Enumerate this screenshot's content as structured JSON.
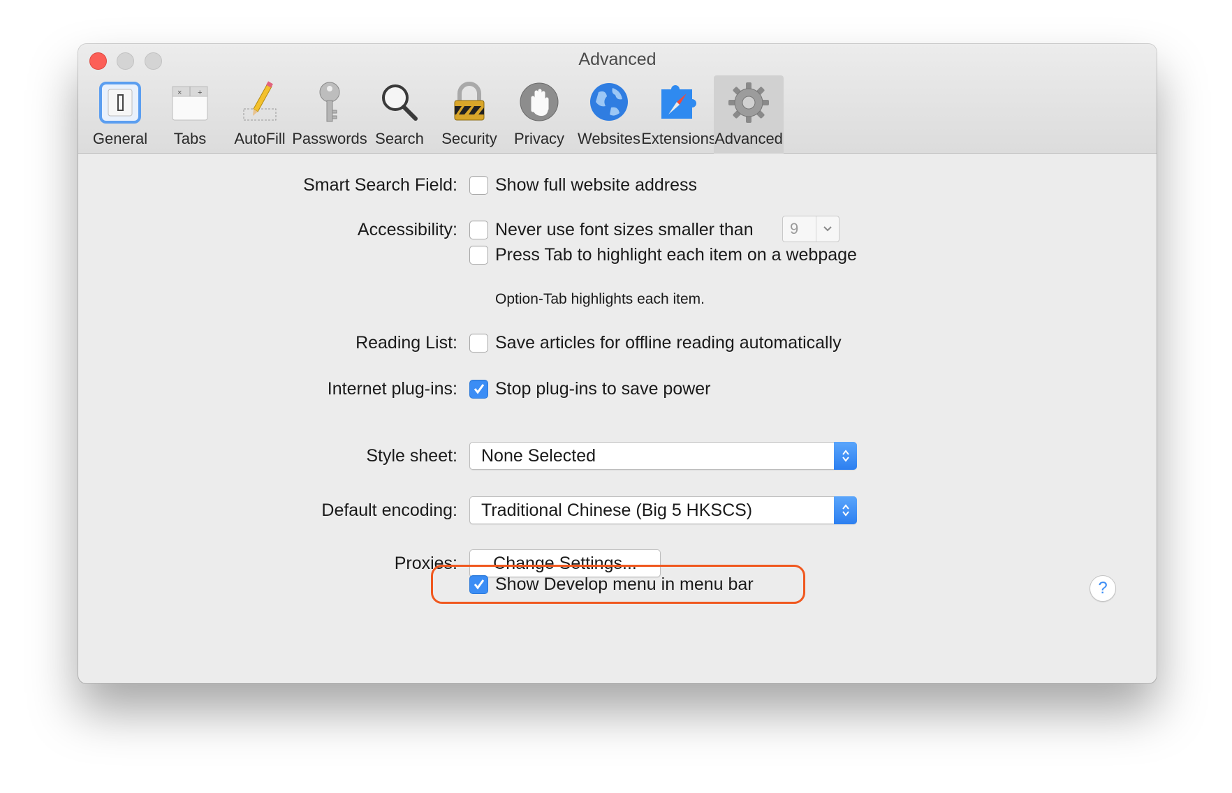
{
  "window": {
    "title": "Advanced"
  },
  "toolbar": {
    "items": [
      {
        "label": "General",
        "icon": "general-icon"
      },
      {
        "label": "Tabs",
        "icon": "tabs-icon"
      },
      {
        "label": "AutoFill",
        "icon": "autofill-pencil-icon"
      },
      {
        "label": "Passwords",
        "icon": "key-icon"
      },
      {
        "label": "Search",
        "icon": "magnifier-icon"
      },
      {
        "label": "Security",
        "icon": "padlock-icon"
      },
      {
        "label": "Privacy",
        "icon": "hand-icon"
      },
      {
        "label": "Websites",
        "icon": "globe-icon"
      },
      {
        "label": "Extensions",
        "icon": "puzzle-compass-icon"
      },
      {
        "label": "Advanced",
        "icon": "gear-icon"
      }
    ],
    "selected": "Advanced"
  },
  "settings": {
    "smart_search": {
      "label": "Smart Search Field:",
      "option": "Show full website address",
      "checked": false
    },
    "accessibility": {
      "label": "Accessibility:",
      "font_option": "Never use font sizes smaller than",
      "font_checked": false,
      "font_size": "9",
      "tab_option": "Press Tab to highlight each item on a webpage",
      "tab_checked": false,
      "tab_note": "Option-Tab highlights each item."
    },
    "reading_list": {
      "label": "Reading List:",
      "option": "Save articles for offline reading automatically",
      "checked": false
    },
    "plugins": {
      "label": "Internet plug-ins:",
      "option": "Stop plug-ins to save power",
      "checked": true
    },
    "style_sheet": {
      "label": "Style sheet:",
      "value": "None Selected"
    },
    "encoding": {
      "label": "Default encoding:",
      "value": "Traditional Chinese (Big 5 HKSCS)"
    },
    "proxies": {
      "label": "Proxies:",
      "button": "Change Settings..."
    },
    "develop": {
      "option": "Show Develop menu in menu bar",
      "checked": true
    }
  },
  "help": {
    "symbol": "?"
  },
  "colors": {
    "accent": "#3b8df5",
    "highlight_outline": "#f0581f",
    "close": "#fc5f57"
  }
}
